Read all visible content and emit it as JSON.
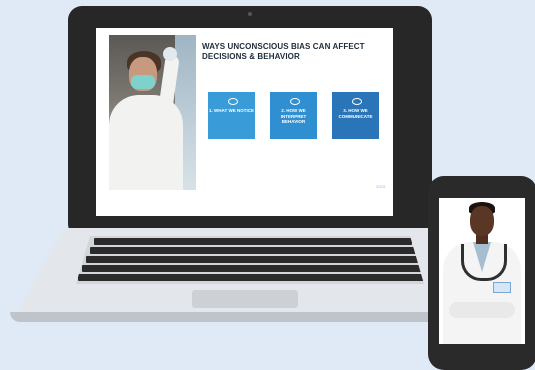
{
  "slide": {
    "title": "WAYS UNCONSCIOUS BIAS CAN AFFECT DECISIONS & BEHAVIOR",
    "boxes": [
      {
        "label": "1. WHAT WE NOTICE",
        "icon": "eye-icon"
      },
      {
        "label": "2. HOW WE INTERPRET BEHAVIOR",
        "icon": "brain-icon"
      },
      {
        "label": "3. HOW WE COMMUNICATE",
        "icon": "hand-icon"
      }
    ],
    "footer": "2023"
  },
  "colors": {
    "background": "#dfeaf6",
    "box1": "#3a9bd9",
    "box2": "#2f8fd0",
    "box3": "#2975b8",
    "device_frame": "#272727"
  }
}
